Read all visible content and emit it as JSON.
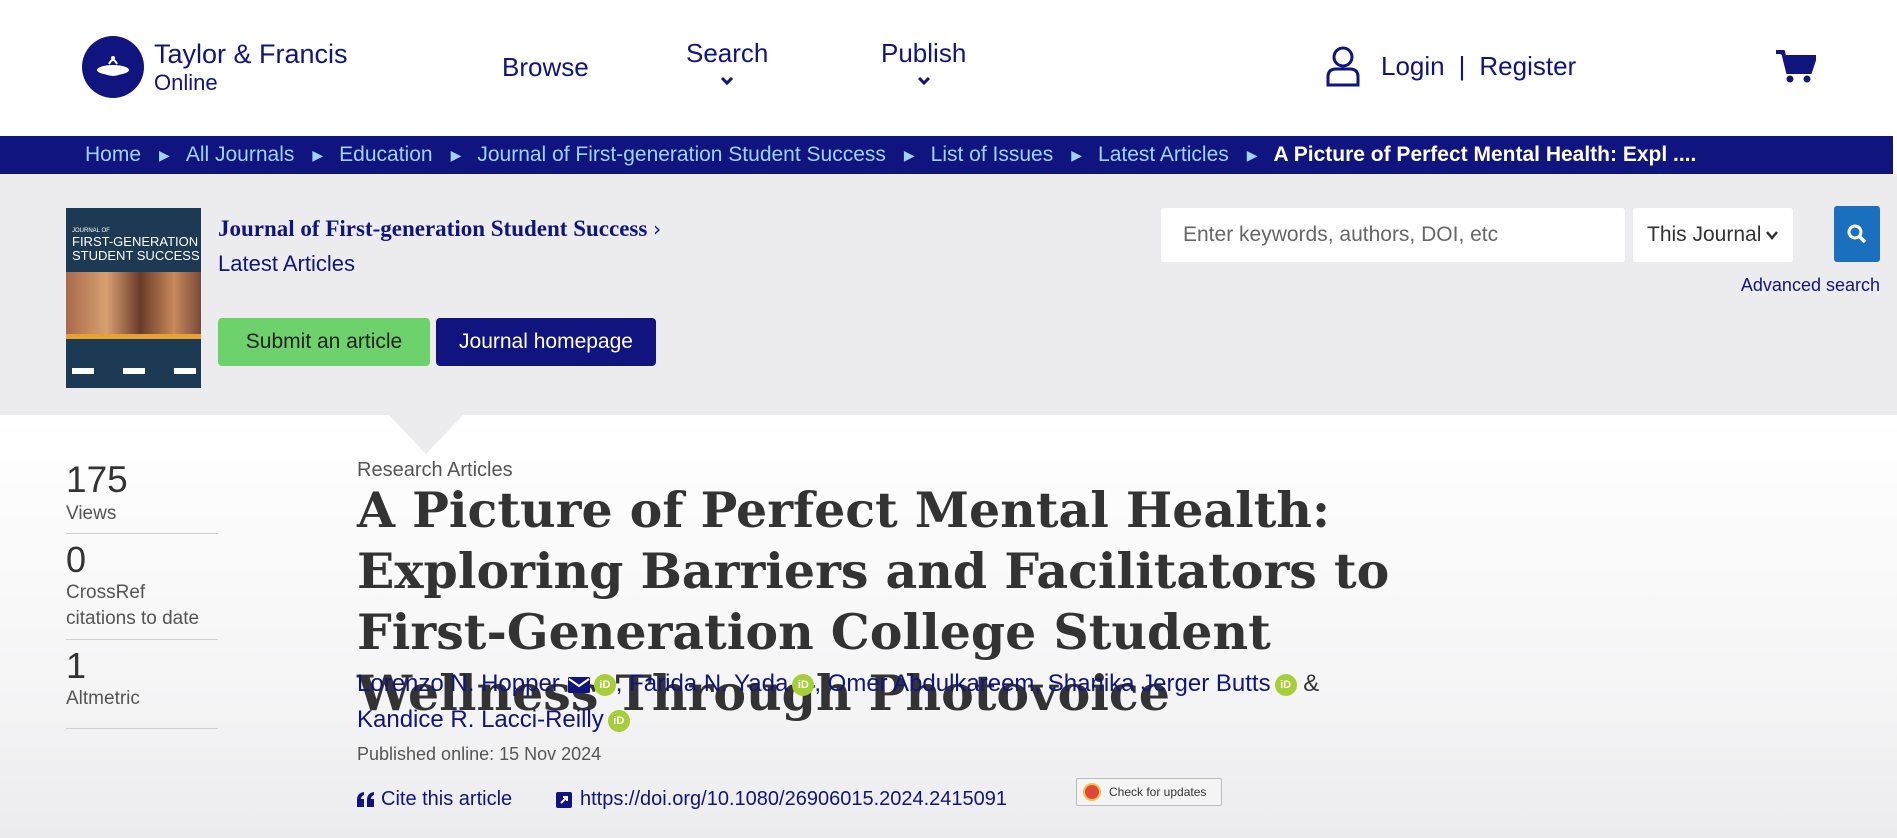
{
  "brand": {
    "name_line1": "Taylor & Francis",
    "name_line2": "Online"
  },
  "nav": {
    "browse": "Browse",
    "search": "Search",
    "publish": "Publish"
  },
  "user": {
    "login": "Login",
    "separator": "|",
    "register": "Register"
  },
  "breadcrumb": [
    {
      "label": "Home"
    },
    {
      "label": "All Journals"
    },
    {
      "label": "Education"
    },
    {
      "label": "Journal of First-generation Student Success"
    },
    {
      "label": "List of Issues"
    },
    {
      "label": "Latest Articles"
    },
    {
      "label": "A Picture of Perfect Mental Health: Expl ...."
    }
  ],
  "journal": {
    "title": "Journal of First-generation Student Success",
    "subtitle": "Latest Articles",
    "cover_title_line1": "JOURNAL OF",
    "cover_title_line2": "FIRST-GENERATION",
    "cover_title_line3": "STUDENT SUCCESS",
    "submit_label": "Submit an article",
    "homepage_label": "Journal homepage"
  },
  "search": {
    "placeholder": "Enter keywords, authors, DOI, etc",
    "scope": "This Journal",
    "advanced": "Advanced search"
  },
  "metrics": [
    {
      "value": "175",
      "label": "Views"
    },
    {
      "value": "0",
      "label": "CrossRef citations to date"
    },
    {
      "value": "1",
      "label": "Altmetric"
    }
  ],
  "article": {
    "section": "Research Articles",
    "title": "A Picture of Perfect Mental Health: Exploring Barriers and Facilitators to First-Generation College Student Wellness Through Photovoice",
    "authors": [
      "Lorenzo N. Hopper",
      "Farida N. Yada",
      "Omer Abdulkareem",
      "Shanika Jerger Butts",
      "Kandice R. Lacci-Reilly"
    ],
    "author_sep": ",",
    "author_and": "&",
    "orcid_label": "iD",
    "published": "Published online: 15 Nov 2024",
    "cite_label": "Cite this article",
    "doi": "https://doi.org/10.1080/26906015.2024.2415091",
    "check_updates": "Check for updates"
  },
  "colors": {
    "brand_navy": "#10147e",
    "breadcrumb_link": "#9fd3ff",
    "submit_green": "#6dd26b",
    "search_blue": "#1a6fbf",
    "orcid_green": "#a6ce39"
  }
}
